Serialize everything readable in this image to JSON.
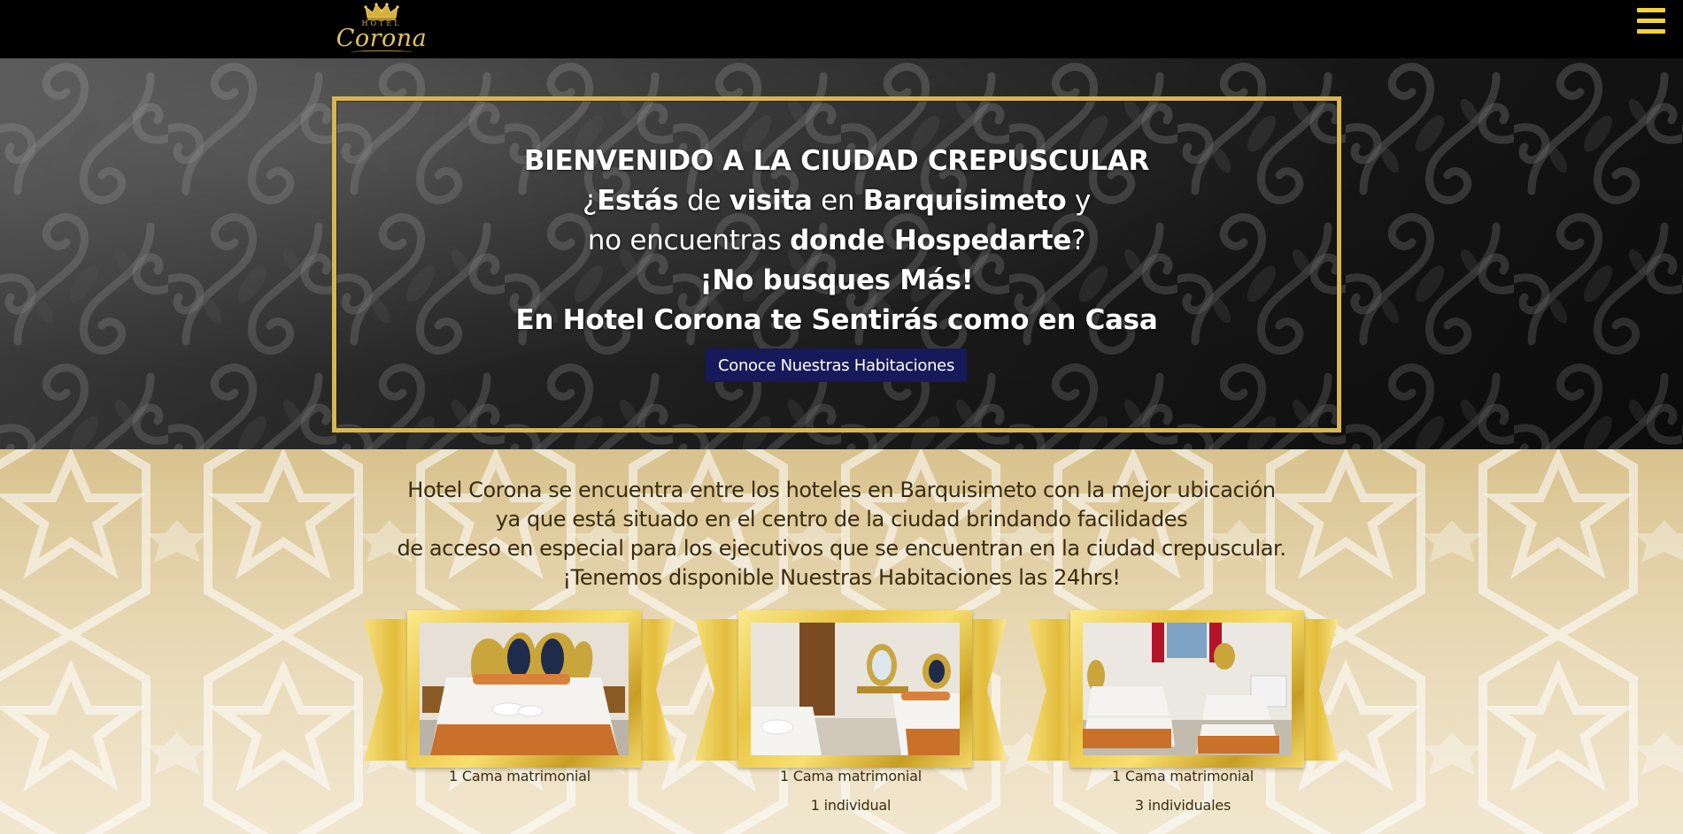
{
  "header": {
    "logo_top": "HOTEL",
    "logo_brand": "Corona"
  },
  "hero": {
    "line1": "BIENVENIDO A LA CIUDAD CREPUSCULAR",
    "line2": {
      "a": "¿",
      "b": "Estás",
      "c": " de ",
      "d": "visita",
      "e": " en ",
      "f": "Barquisimeto",
      "g": " y"
    },
    "line3": {
      "a": "no encuentras ",
      "b": "donde Hospedarte",
      "c": "?"
    },
    "line4": "¡No busques Más!",
    "line5": "En Hotel Corona te Sentirás como en Casa",
    "cta_label": "Conoce Nuestras Habitaciones"
  },
  "info": {
    "lines": [
      "Hotel Corona se encuentra entre los hoteles en Barquisimeto con la mejor ubicación",
      "ya que está situado en el centro de la ciudad brindando facilidades",
      "de acceso en especial para los ejecutivos que se encuentran en la ciudad crepuscular.",
      "¡Tenemos disponible Nuestras Habitaciones las 24hrs!"
    ]
  },
  "rooms": [
    {
      "caption1": "1 Cama matrimonial",
      "caption2": ""
    },
    {
      "caption1": "1 Cama matrimonial",
      "caption2": "1 individual"
    },
    {
      "caption1": "1 Cama matrimonial",
      "caption2": "3 individuales"
    }
  ],
  "colors": {
    "gold": "#d7b552",
    "menu_yellow": "#f4d23b",
    "cta_navy": "#16195a",
    "text_brown": "#3a2c0e"
  },
  "icons": {
    "menu": "hamburger-icon",
    "logo": "crown-icon"
  }
}
